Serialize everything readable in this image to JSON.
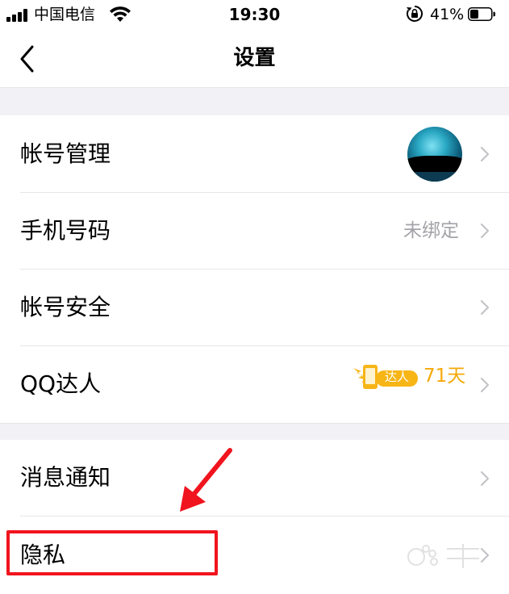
{
  "status_bar": {
    "carrier": "中国电信",
    "time": "19:30",
    "battery": "41%",
    "battery_level": 0.41
  },
  "nav": {
    "title": "设置"
  },
  "settings": {
    "account_management": {
      "label": "帐号管理"
    },
    "phone_number": {
      "label": "手机号码",
      "value": "未绑定"
    },
    "account_security": {
      "label": "帐号安全"
    },
    "qq_expert": {
      "label": "QQ达人",
      "badge_text": "达人",
      "days": "71天"
    },
    "notifications": {
      "label": "消息通知"
    },
    "privacy": {
      "label": "隐私"
    }
  },
  "icons": [
    "signal-icon",
    "wifi-icon",
    "rotation-lock-icon",
    "battery-icon",
    "back-chevron-icon",
    "chevron-right-icon",
    "qq-expert-badge-icon",
    "red-arrow-annotation"
  ],
  "colors": {
    "accent_orange": "#f5a90a",
    "annotation_red": "#f0141e",
    "section_gap": "#f2f2f6",
    "secondary_text": "#a3a3a8"
  }
}
